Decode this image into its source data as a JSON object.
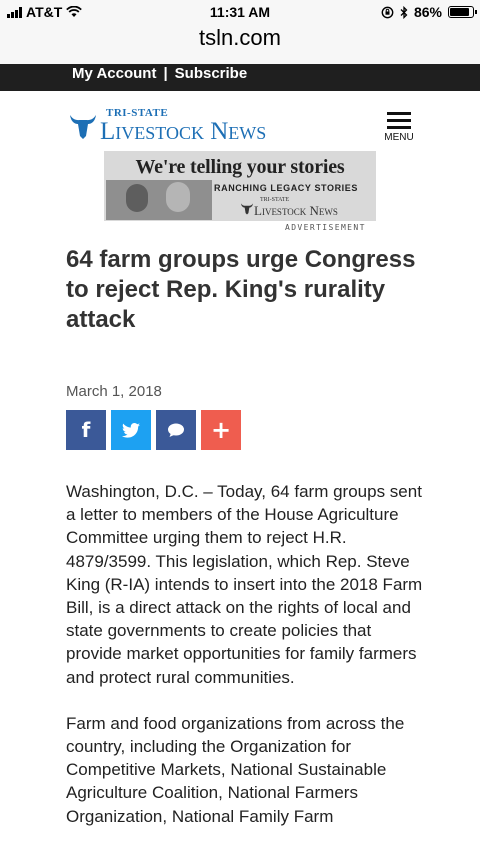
{
  "status_bar": {
    "carrier": "AT&T",
    "time": "11:31 AM",
    "battery": "86%",
    "battery_level": 0.86
  },
  "browser": {
    "url": "tsln.com"
  },
  "account_bar": {
    "my_account": "My Account",
    "separator": "|",
    "subscribe": "Subscribe"
  },
  "header": {
    "logo_top": "TRI-STATE",
    "logo_main": "Livestock News",
    "menu_label": "MENU"
  },
  "ad": {
    "headline": "We're telling your stories",
    "subline": "RANCHING LEGACY STORIES",
    "logo_top": "TRI-STATE",
    "logo_main": "Livestock News",
    "label": "ADVERTISEMENT"
  },
  "article": {
    "title": "64 farm groups urge Congress to reject Rep. King's rurality attack",
    "date": "March 1, 2018",
    "share": {
      "facebook": "f",
      "comment": "•••",
      "plus": "+"
    },
    "paragraphs": [
      "Washington, D.C. – Today, 64 farm groups sent a letter to members of the House Agriculture Committee urging them to reject H.R. 4879/3599. This legislation, which Rep. Steve King (R-IA) intends to insert into the 2018 Farm Bill, is a direct attack on the rights of local and state governments to create policies that provide market opportunities for family farmers and protect rural communities.",
      "Farm and food organizations from across the country, including the Organization for Competitive Markets, National Sustainable Agriculture Coalition, National Farmers Organization, National Family Farm"
    ]
  },
  "colors": {
    "facebook": "#3b5998",
    "twitter": "#1da1f2",
    "plus": "#ef5d4f",
    "logo_blue": "#1d6fb5"
  }
}
